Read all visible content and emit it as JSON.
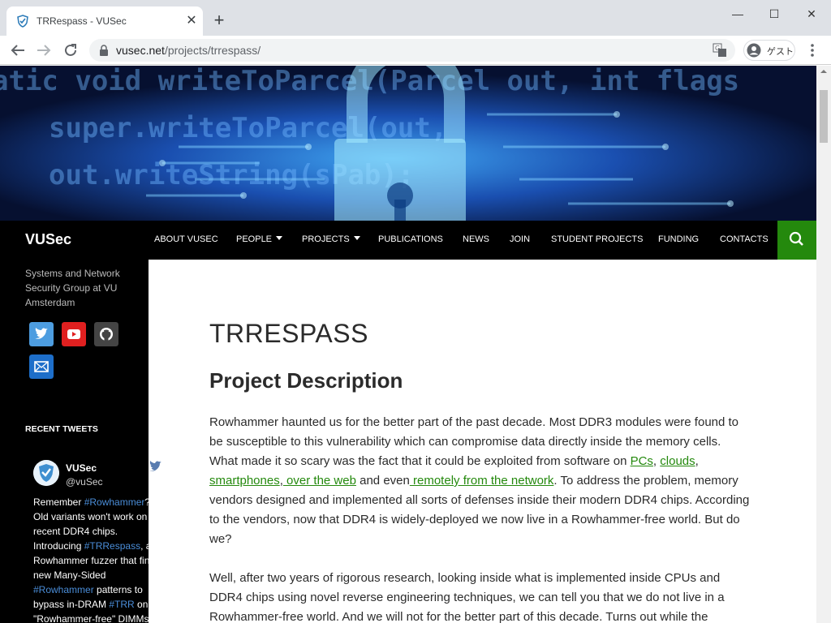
{
  "browser": {
    "tab_title": "TRRespass - VUSec",
    "tab_close": "✕",
    "new_tab": "+",
    "url_host": "vusec.net",
    "url_path": "/projects/trrespass/",
    "profile_label": "ゲスト",
    "minimize": "—",
    "maximize": "☐",
    "close": "✕"
  },
  "site": {
    "title": "VUSec",
    "tagline": "Systems and Network Security Group at VU Amsterdam",
    "nav": [
      {
        "label": "ABOUT VUSEC"
      },
      {
        "label": "PEOPLE"
      },
      {
        "label": "PROJECTS"
      },
      {
        "label": "PUBLICATIONS"
      },
      {
        "label": "NEWS"
      },
      {
        "label": "JOIN"
      },
      {
        "label": "STUDENT PROJECTS"
      },
      {
        "label": "FUNDING"
      },
      {
        "label": "CONTACTS"
      }
    ],
    "social_icons": [
      "twitter-icon",
      "youtube-icon",
      "github-icon",
      "email-icon"
    ],
    "accent": "#24890d"
  },
  "sidebar": {
    "recent_tweets_heading": "RECENT TWEETS",
    "tweet": {
      "name": "VUSec",
      "handle": "@vuSec",
      "lines": [
        {
          "text": "Remember ",
          "tag": "#Rowhammer",
          "rest": "?"
        },
        {
          "text": "Old variants won't work on",
          "tag": "",
          "rest": ""
        },
        {
          "text": "recent DDR4 chips.",
          "tag": "",
          "rest": ""
        },
        {
          "text": "Introducing ",
          "tag": "#TRRespass",
          "rest": ", a"
        },
        {
          "text": "Rowhammer fuzzer that fin",
          "tag": "",
          "rest": ""
        },
        {
          "text": "new Many-Sided",
          "tag": "",
          "rest": ""
        },
        {
          "text": "",
          "tag": "#Rowhammer",
          "rest": " patterns to"
        },
        {
          "text": "bypass in-DRAM ",
          "tag": "#TRR",
          "rest": " on"
        },
        {
          "text": "\"Rowhammer-free\" DIMMs",
          "tag": "",
          "rest": ""
        }
      ]
    }
  },
  "article": {
    "title": "TRRESPASS",
    "section_heading": "Project Description",
    "p1_a": "Rowhammer haunted us for the better part of the past decade. Most DDR3 modules were found to be susceptible to this vulnerability which can compromise data directly inside the memory cells. What made it so scary was the fact that it could be exploited from software on ",
    "link_pcs": "PCs",
    "sep1": ", ",
    "link_clouds": "clouds",
    "sep2": ", ",
    "link_smartphones": "smartphones",
    "sep3": ",",
    "link_web": " over the web",
    "p1_b": " and even",
    "link_network": " remotely from the network",
    "p1_c": ". To address the problem, memory vendors designed and implemented all sorts of defenses inside their modern DDR4 chips. According to the vendors, now that DDR4 is widely-deployed we now live in a Rowhammer-free world. But do we?",
    "p2": "Well, after two years of rigorous research, looking inside what is implemented inside CPUs and DDR4 chips using novel reverse engineering techniques, we can tell you that we do not live in a Rowhammer-free world. And we will not for the better part of this decade. Turns out while the"
  }
}
